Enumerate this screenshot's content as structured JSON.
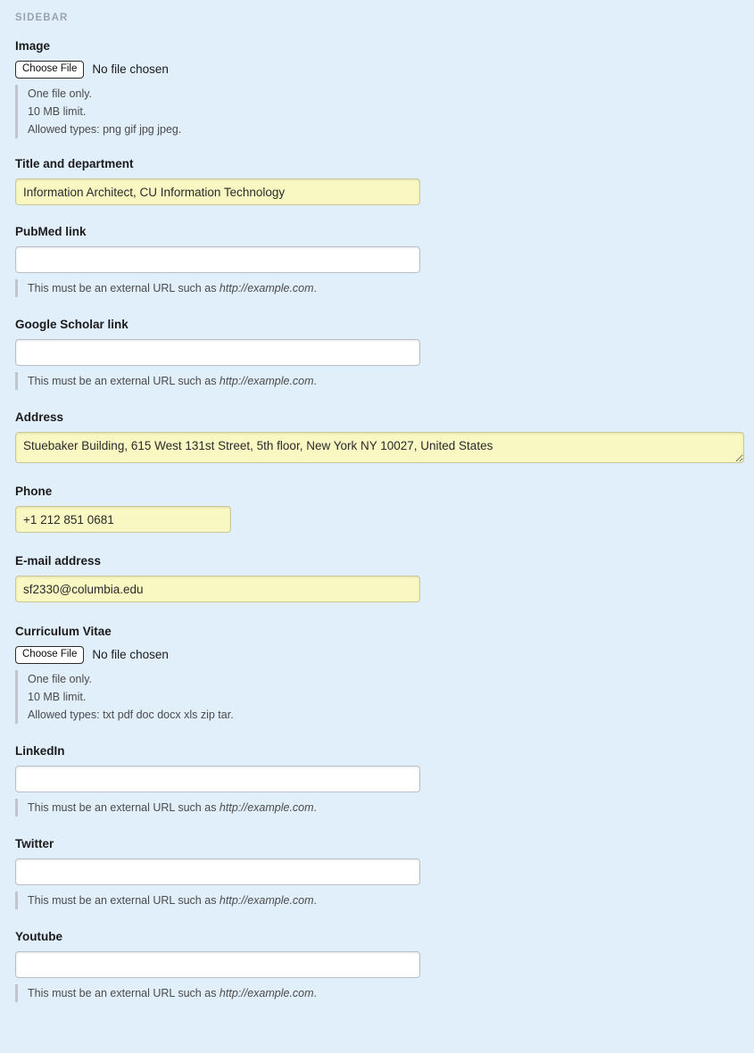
{
  "region": {
    "title": "SIDEBAR"
  },
  "common": {
    "choose_file_label": "Choose File",
    "no_file_chosen": "No file chosen",
    "one_file_only": "One file only.",
    "size_limit": "10 MB limit.",
    "external_url_hint_prefix": "This must be an external URL such as ",
    "external_url_hint_example": "http://example.com",
    "external_url_hint_suffix": "."
  },
  "fields": {
    "image": {
      "label": "Image",
      "choose_file_label": "Choose File",
      "file_status": "No file chosen",
      "hint_one_file": "One file only.",
      "hint_limit": "10 MB limit.",
      "hint_types": "Allowed types: png gif jpg jpeg."
    },
    "title_department": {
      "label": "Title and department",
      "value": "Information Architect, CU Information Technology",
      "placeholder": ""
    },
    "pubmed": {
      "label": "PubMed link",
      "value": "",
      "placeholder": "",
      "hint_prefix": "This must be an external URL such as ",
      "hint_example": "http://example.com",
      "hint_suffix": "."
    },
    "google_scholar": {
      "label": "Google Scholar link",
      "value": "",
      "placeholder": "",
      "hint_prefix": "This must be an external URL such as ",
      "hint_example": "http://example.com",
      "hint_suffix": "."
    },
    "address": {
      "label": "Address",
      "value": "Stuebaker Building, 615 West 131st Street, 5th floor, New York NY 10027, United States",
      "placeholder": ""
    },
    "phone": {
      "label": "Phone",
      "value": "+1 212 851 0681",
      "placeholder": ""
    },
    "email": {
      "label": "E-mail address",
      "value": "sf2330@columbia.edu",
      "placeholder": ""
    },
    "curriculum_vitae": {
      "label": "Curriculum Vitae",
      "choose_file_label": "Choose File",
      "file_status": "No file chosen",
      "hint_one_file": "One file only.",
      "hint_limit": "10 MB limit.",
      "hint_types": "Allowed types: txt pdf doc docx xls zip tar."
    },
    "linkedin": {
      "label": "LinkedIn",
      "value": "",
      "placeholder": "",
      "hint_prefix": "This must be an external URL such as ",
      "hint_example": "http://example.com",
      "hint_suffix": "."
    },
    "twitter": {
      "label": "Twitter",
      "value": "",
      "placeholder": "",
      "hint_prefix": "This must be an external URL such as ",
      "hint_example": "http://example.com",
      "hint_suffix": "."
    },
    "youtube": {
      "label": "Youtube",
      "value": "",
      "placeholder": "",
      "hint_prefix": "This must be an external URL such as ",
      "hint_example": "http://example.com",
      "hint_suffix": "."
    }
  },
  "colors": {
    "page_background": "#e1effb",
    "filled_field_background": "#f9f8c3",
    "filled_field_border": "#c9c79a",
    "empty_field_background": "#ffffff",
    "empty_field_border": "#b9bfc6",
    "hint_bar": "#bfc5cb",
    "region_title_text": "#9aa3ad"
  }
}
